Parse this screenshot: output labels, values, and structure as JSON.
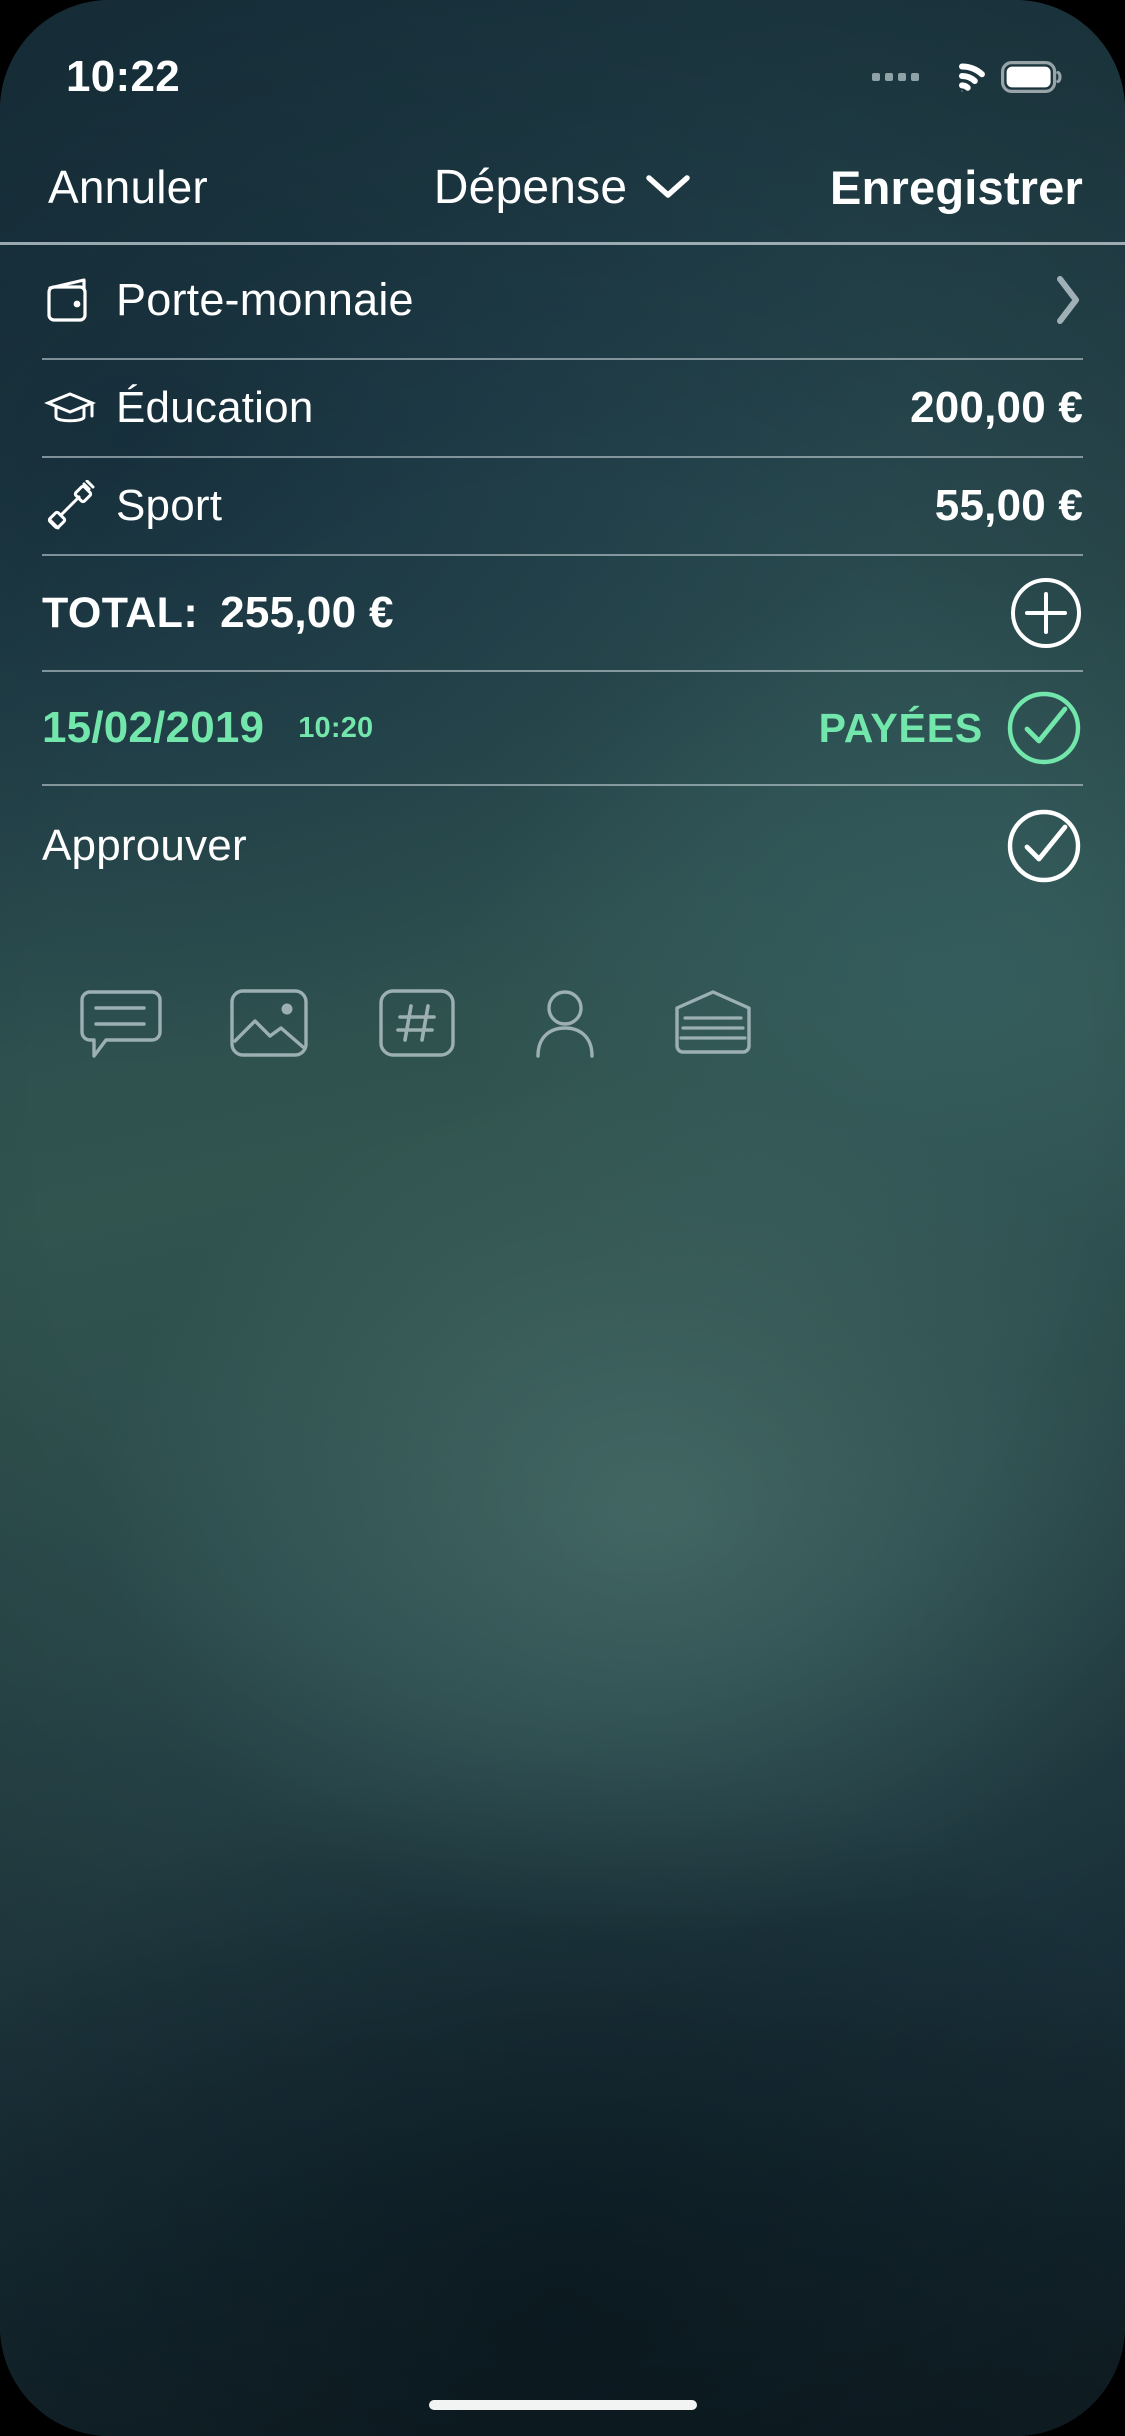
{
  "status_bar": {
    "time": "10:22",
    "signal_icon": "signal-dots-icon",
    "wifi_icon": "wifi-icon",
    "battery_icon": "battery-full-icon"
  },
  "nav_bar": {
    "cancel_label": "Annuler",
    "title": "Dépense",
    "title_chevron_icon": "chevron-down-icon",
    "save_label": "Enregistrer"
  },
  "colors": {
    "accent_green": "#72e6ab",
    "text_white": "#ffffff",
    "separator": "rgba(190,203,208,0.62)",
    "background_dark_teal": "#1c3a47"
  },
  "rows": {
    "wallet": {
      "icon": "wallet-icon",
      "label": "Porte-monnaie",
      "chevron_icon": "chevron-right-icon"
    },
    "items": [
      {
        "icon": "graduation-cap-icon",
        "label": "Éducation",
        "amount": "200,00 €"
      },
      {
        "icon": "dumbbell-icon",
        "label": "Sport",
        "amount": "55,00 €"
      }
    ],
    "total": {
      "label": "TOTAL:",
      "amount": "255,00 €",
      "add_icon": "plus-circle-icon"
    },
    "date": {
      "date": "15/02/2019",
      "time": "10:20",
      "status_label": "PAYÉES",
      "check_icon": "check-circle-icon"
    },
    "approve": {
      "label": "Approuver",
      "check_icon": "check-circle-icon"
    }
  },
  "toolbar": {
    "items": [
      {
        "icon": "comment-bubble-icon",
        "name": "note"
      },
      {
        "icon": "photo-image-icon",
        "name": "photo"
      },
      {
        "icon": "hashtag-tag-icon",
        "name": "tag"
      },
      {
        "icon": "person-icon",
        "name": "person"
      },
      {
        "icon": "archive-drawer-icon",
        "name": "archive"
      }
    ]
  },
  "home_indicator": "home-indicator"
}
